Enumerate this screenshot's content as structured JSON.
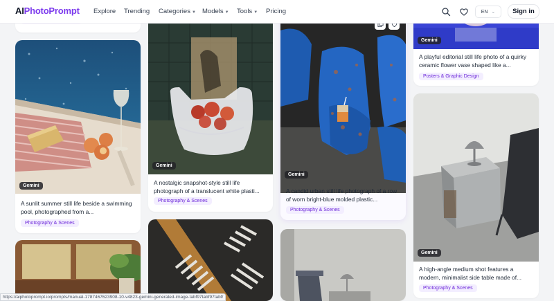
{
  "nav": {
    "logo_ai": "AI",
    "logo_rest": "PhotoPrompt",
    "links": [
      "Explore",
      "Trending",
      "Categories",
      "Models",
      "Tools",
      "Pricing"
    ],
    "language": "EN",
    "signin": "Sign in",
    "icons": [
      "search-icon",
      "heart-icon",
      "chevron-down-icon"
    ]
  },
  "cards": {
    "pool": {
      "model": "Gemini",
      "description": "A sunlit summer still life beside a swimming pool, photographed from a...",
      "tag": "Photography & Scenes"
    },
    "bag": {
      "model": "Gemini",
      "description": "A nostalgic snapshot-style still life photograph of a translucent white plasti...",
      "tag": "Photography & Scenes"
    },
    "chairs": {
      "model": "Gemini",
      "description": "A candid urban still life photograph of a row of worn bright-blue molded plastic...",
      "tag": "Photography & Scenes"
    },
    "vase": {
      "model": "Gemini",
      "description": "A playful editorial still life photo of a quirky ceramic flower vase shaped like a...",
      "tag": "Posters & Graphic Design"
    },
    "table": {
      "model": "Gemini",
      "description": "A high-angle medium shot features a modern, minimalist side table made of...",
      "tag": "Photography & Scenes"
    }
  },
  "status_url": "https://aiphotoprompt.io/prompts/manual-1787467623908-10-v4823-gemini-generated-image-tabf97tabf97tabf/",
  "colors": {
    "brand": "#7c3aed",
    "tag_bg": "#f3eeff",
    "tag_text": "#6d28d9"
  }
}
